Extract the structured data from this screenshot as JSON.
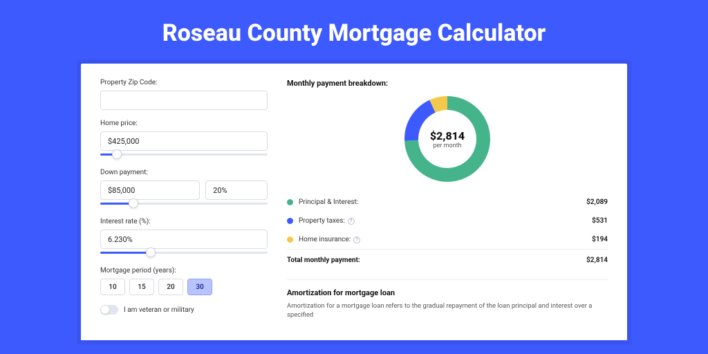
{
  "header": {
    "title": "Roseau County Mortgage Calculator"
  },
  "form": {
    "zip": {
      "label": "Property Zip Code:",
      "value": ""
    },
    "price": {
      "label": "Home price:",
      "value": "$425,000",
      "slider_pct": 10
    },
    "down": {
      "label": "Down payment:",
      "amount": "$85,000",
      "percent": "20%",
      "slider_pct": 20
    },
    "rate": {
      "label": "Interest rate (%):",
      "value": "6.230%",
      "slider_pct": 30
    },
    "period": {
      "label": "Mortgage period (years):",
      "options": [
        "10",
        "15",
        "20",
        "30"
      ],
      "active": "30"
    },
    "veteran_label": "I am veteran or military"
  },
  "breakdown": {
    "title": "Monthly payment breakdown:",
    "total_amount": "$2,814",
    "per_month": "per month",
    "items": [
      {
        "label": "Principal & Interest:",
        "value": "$2,089",
        "color": "#46b48b",
        "info": false
      },
      {
        "label": "Property taxes:",
        "value": "$531",
        "color": "#3d5afe",
        "info": true
      },
      {
        "label": "Home insurance:",
        "value": "$194",
        "color": "#f4c94b",
        "info": true
      }
    ],
    "total_label": "Total monthly payment:",
    "total_value": "$2,814"
  },
  "amortization": {
    "title": "Amortization for mortgage loan",
    "body": "Amortization for a mortgage loan refers to the gradual repayment of the loan principal and interest over a specified"
  },
  "chart_data": {
    "type": "pie",
    "title": "Monthly payment breakdown",
    "series": [
      {
        "name": "Principal & Interest",
        "value": 2089,
        "color": "#46b48b"
      },
      {
        "name": "Property taxes",
        "value": 531,
        "color": "#3d5afe"
      },
      {
        "name": "Home insurance",
        "value": 194,
        "color": "#f4c94b"
      }
    ],
    "center_label": "$2,814 per month",
    "total": 2814
  }
}
